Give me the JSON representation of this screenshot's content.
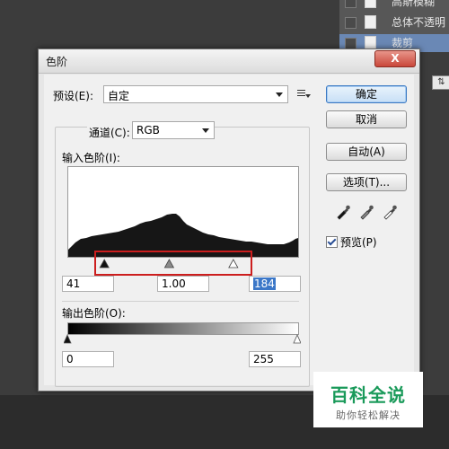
{
  "layers_panel": {
    "items": [
      {
        "name": "高斯模糊"
      },
      {
        "name": "总体不透明"
      },
      {
        "name": "裁剪"
      }
    ],
    "small_box_label": "⇅"
  },
  "dialog": {
    "title": "色阶",
    "close_label": "X",
    "preset": {
      "label": "预设(E):",
      "value": "自定"
    },
    "channel": {
      "label": "通道(C):",
      "value": "RGB"
    },
    "input_levels": {
      "label": "输入色阶(I):",
      "black": "41",
      "gamma": "1.00",
      "white": "184",
      "black_point_fraction": 0.161,
      "gamma_fraction": 0.443,
      "white_point_fraction": 0.722
    },
    "output_levels": {
      "label": "输出色阶(O):",
      "black": "0",
      "white": "255"
    },
    "buttons": {
      "ok": "确定",
      "cancel": "取消",
      "auto": "自动(A)",
      "options": "选项(T)..."
    },
    "eyedroppers": [
      "black-eyedropper-icon",
      "gray-eyedropper-icon",
      "white-eyedropper-icon"
    ],
    "preview": {
      "label": "预览(P)",
      "checked": true
    }
  },
  "watermark": {
    "title": "百科全说",
    "subtitle": "助你轻松解决"
  },
  "colors": {
    "highlight_box": "#cc1e1e",
    "default_button_border": "#3a78c2",
    "watermark_green": "#1a9a5a"
  }
}
